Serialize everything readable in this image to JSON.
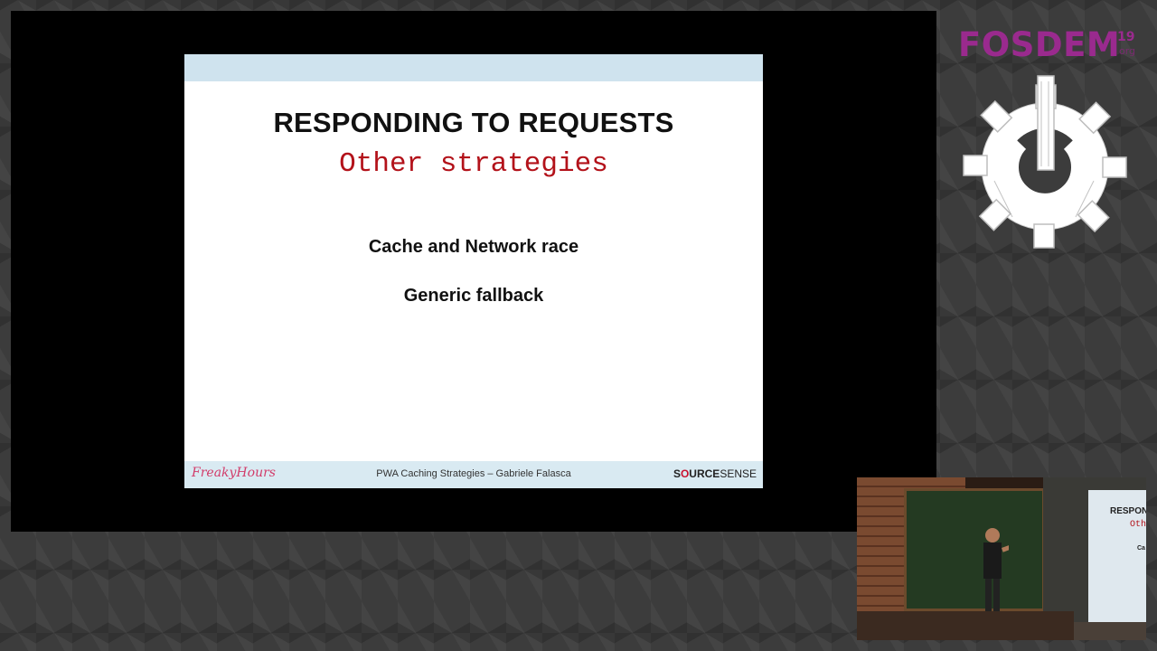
{
  "slide": {
    "title": "RESPONDING TO REQUESTS",
    "subtitle": "Other strategies",
    "items": [
      "Cache and Network race",
      "Generic fallback"
    ],
    "footer": {
      "brand_left": "FreakyHours",
      "caption": "PWA Caching Strategies – Gabriele Falasca",
      "brand_right": {
        "prefix": "S",
        "o": "O",
        "mid": "URCE",
        "suffix": "SENSE"
      }
    }
  },
  "branding": {
    "name": "FOSDEM",
    "year": "19",
    "domain": "org"
  },
  "camera_view": {
    "projection_title": "RESPON",
    "projection_subtitle": "Oth",
    "projection_item": "Ca"
  },
  "colors": {
    "fosdem_purple": "#9a2a8e",
    "subtitle_red": "#b3121a",
    "slide_bar_blue": "#cfe3ee"
  }
}
